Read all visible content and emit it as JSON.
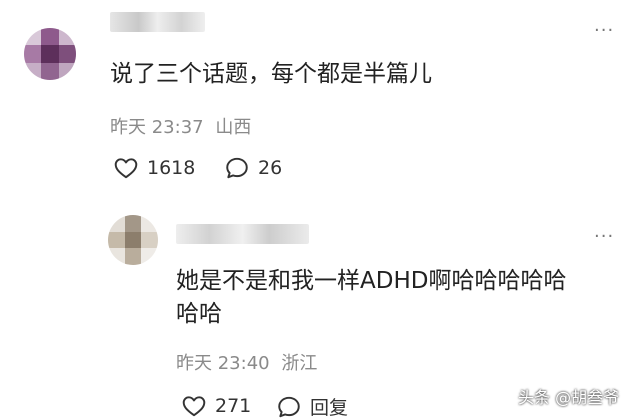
{
  "comment_1": {
    "text": "说了三个话题，每个都是半篇儿",
    "date": "昨天 23:37",
    "location": "山西",
    "like_count": "1618",
    "reply_count": "26",
    "more": "···",
    "avatar_icon": "blurred-avatar-icon"
  },
  "comment_2": {
    "text_line1": "她是不是和我一样ADHD啊哈哈哈哈哈",
    "text_line2": "哈哈",
    "date": "昨天 23:40",
    "location": "浙江",
    "like_count": "271",
    "reply_label": "回复",
    "more": "···",
    "avatar_icon": "blurred-avatar-icon"
  },
  "watermark": {
    "text": "头条 @胡叁爷"
  }
}
